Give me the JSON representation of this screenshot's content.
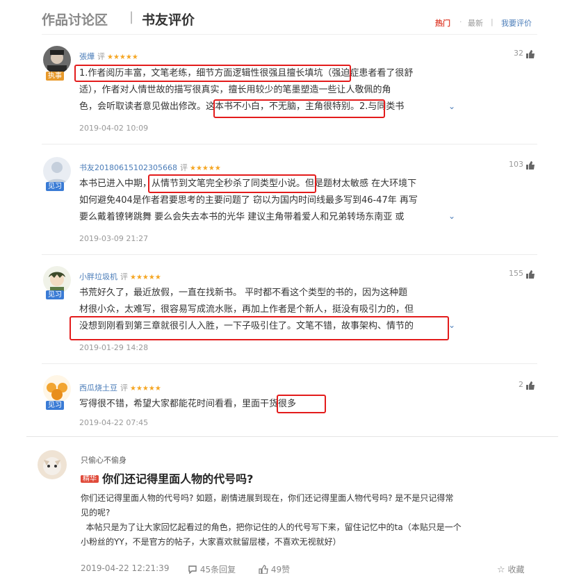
{
  "header": {
    "title_left": "作品讨论区",
    "separator": "|",
    "title_right": "书友评价"
  },
  "sort": {
    "hot": "热门",
    "dot": "·",
    "latest": "最新",
    "sep": "|",
    "my_review": "我要评价"
  },
  "reviews": [
    {
      "name": "張燁",
      "tag": "评",
      "stars": "★★★★★",
      "badge": "执事",
      "likes": "32",
      "lines": [
        "1.作者阅历丰富，文笔老练，细节方面逻辑性很强且擅长填坑（强迫症患者看了很舒",
        "适），作者对人情世故的描写很真实，擅长用较少的笔墨塑造一些让人敬佩的角",
        "色，会听取读者意见做出修改。这本书不小白，不无脑，主角很特别。2.与同类书"
      ],
      "date": "2019-04-02 10:09"
    },
    {
      "name": "书友20180615102305668",
      "tag": "评",
      "stars": "★★★★★",
      "badge": "见习",
      "likes": "103",
      "lines": [
        "本书已进入中期，从情节到文笔完全秒杀了同类型小说。但是题材太敏感 在大环境下",
        "如何避免404是作者君要思考的主要问题了 窃以为国内时间线最多写到46-47年 再写",
        "要么戴着镣铐跳舞 要么会失去本书的光华 建议主角带着爱人和兄弟转场东南亚 或"
      ],
      "date": "2019-03-09 21:27"
    },
    {
      "name": "小胖垃圾机",
      "tag": "评",
      "stars": "★★★★★",
      "badge": "见习",
      "likes": "155",
      "lines": [
        "书荒好久了，最近放假，一直在找新书。 平时都不看这个类型的书的，因为这种题",
        "材很小众，太难写，很容易写成流水账，再加上作者是个新人，挺没有吸引力的，但",
        "没想到刚看到第三章就很引人入胜，一下子吸引住了。文笔不错，故事架构、情节的"
      ],
      "date": "2019-01-29 14:28"
    },
    {
      "name": "西瓜烧土豆",
      "tag": "评",
      "stars": "★★★★★",
      "badge": "见习",
      "likes": "2",
      "lines": [
        "写得很不错，希望大家都能花时间看看，里面干货很多"
      ],
      "date": "2019-04-22 07:45"
    }
  ],
  "post": {
    "author": "只偷心不偷身",
    "badge": "精华",
    "title": "你们还记得里面人物的代号吗?",
    "lines": [
      "你们还记得里面人物的代号吗? 如题，剧情进展到现在，你们还记得里面人物代号吗? 是不是只记得常",
      "见的呢?",
      "  本帖只是为了让大家回忆起看过的角色，把你记住的人的代号写下来，留住记忆中的ta（本贴只是一个",
      "小粉丝的YY，不是官方的帖子，大家喜欢就留层楼，不喜欢无视就好）"
    ],
    "date": "2019-04-22 12:21:39",
    "replies": "45条回复",
    "likes": "49赞",
    "fav": "收藏"
  },
  "colors": {
    "accent": "#e04a3a",
    "link": "#4a7cb8",
    "highlight": "#e31b1b",
    "star": "#f5a623"
  }
}
